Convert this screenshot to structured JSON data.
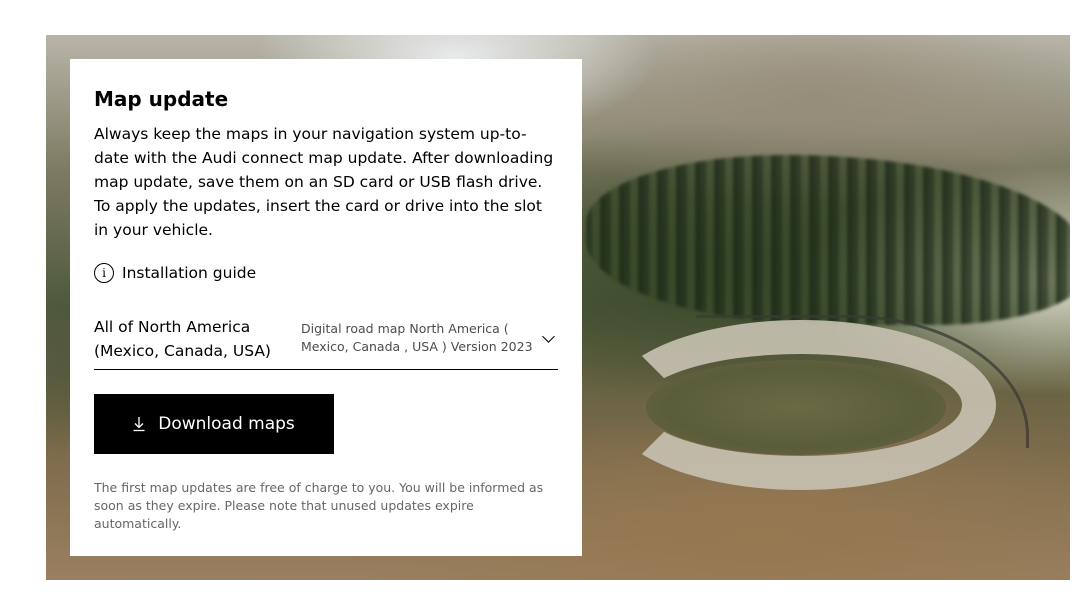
{
  "map_update": {
    "title": "Map update",
    "description": "Always keep the maps in your navigation system up-to-date with the Audi connect map update. After downloading map update, save them on an SD card or USB flash drive. To apply the updates, insert the card or drive into the slot in your vehicle.",
    "installation_guide_label": "Installation guide",
    "region_select": {
      "selected_region": "All of North America (Mexico, Canada, USA)",
      "selected_version": "Digital road map North America ( Mexico, Canada , USA ) Version 2023"
    },
    "download_button_label": "Download maps",
    "footnote": "The first map updates are free of charge to you. You will be informed as soon as they expire. Please note that unused updates expire automatically."
  },
  "icons": {
    "info": "info-circle-icon",
    "dropdown": "chevron-down-icon",
    "download": "download-icon"
  },
  "colors": {
    "button_background": "#000000",
    "button_text": "#ffffff",
    "card_background": "#ffffff",
    "footnote_text": "#666666"
  }
}
